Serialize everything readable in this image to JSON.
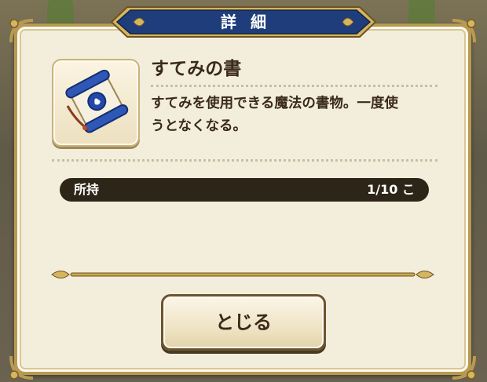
{
  "dialog": {
    "title": "詳細"
  },
  "item": {
    "name": "すてみの書",
    "description": "すてみを使用できる魔法の書物。一度使\nうとなくなる。",
    "icon": "scroll-icon"
  },
  "owned": {
    "label": "所持",
    "value": "1/10 こ"
  },
  "buttons": {
    "close_label": "とじる"
  },
  "colors": {
    "banner_blue": "#1f3d7a",
    "frame_gold": "#b89a52",
    "panel_bg": "#f3eedc",
    "text_dark": "#3a2a18",
    "bar_dark": "#2d2518"
  }
}
